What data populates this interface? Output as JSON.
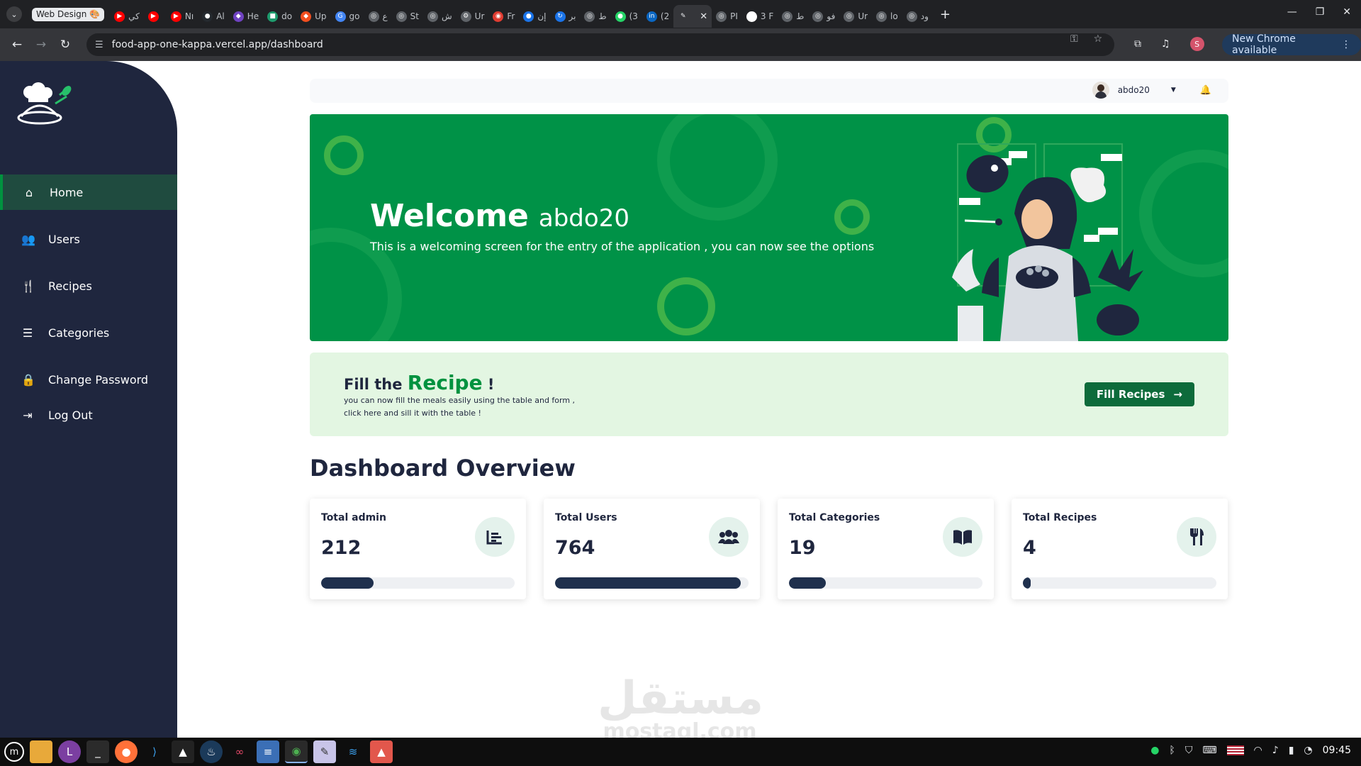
{
  "browser": {
    "group_chip": "Web Design 🎨",
    "tabs": [
      {
        "label": "كي",
        "color": "#ff0000",
        "glyph": "▶"
      },
      {
        "label": "",
        "color": "#ff0000",
        "glyph": "▶"
      },
      {
        "label": "Nı",
        "color": "#ff0000",
        "glyph": "▶"
      },
      {
        "label": "Al",
        "color": "#24292e",
        "glyph": "●"
      },
      {
        "label": "He",
        "color": "#6f42c1",
        "glyph": "◆"
      },
      {
        "label": "do",
        "color": "#1d9a6c",
        "glyph": "■"
      },
      {
        "label": "Up",
        "color": "#f24e1e",
        "glyph": "◆"
      },
      {
        "label": "go",
        "color": "#4285f4",
        "glyph": "G"
      },
      {
        "label": "ع",
        "color": "#5f6368",
        "glyph": "◎"
      },
      {
        "label": "St",
        "color": "#5f6368",
        "glyph": "◎"
      },
      {
        "label": "ش",
        "color": "#5f6368",
        "glyph": "◎"
      },
      {
        "label": "Ur",
        "color": "#5f6368",
        "glyph": "⚙"
      },
      {
        "label": "Fr",
        "color": "#e03c31",
        "glyph": "◉"
      },
      {
        "label": "إن",
        "color": "#1a73e8",
        "glyph": "●"
      },
      {
        "label": "بر",
        "color": "#1a73e8",
        "glyph": "↻"
      },
      {
        "label": "ط",
        "color": "#5f6368",
        "glyph": "◎"
      },
      {
        "label": "(3",
        "color": "#25d366",
        "glyph": "●"
      },
      {
        "label": "(2",
        "color": "#0a66c2",
        "glyph": "in"
      }
    ],
    "active_tab": {
      "label": "",
      "glyph": "✎"
    },
    "tabs_right": [
      {
        "label": "PI",
        "color": "#5f6368",
        "glyph": "◎"
      },
      {
        "label": "3 F",
        "color": "#ffffff",
        "glyph": "i"
      },
      {
        "label": "ط",
        "color": "#5f6368",
        "glyph": "◎"
      },
      {
        "label": "فو",
        "color": "#5f6368",
        "glyph": "◎"
      },
      {
        "label": "Ur",
        "color": "#5f6368",
        "glyph": "◎"
      },
      {
        "label": "lo",
        "color": "#5f6368",
        "glyph": "◎"
      },
      {
        "label": "ود",
        "color": "#5f6368",
        "glyph": "◎"
      }
    ],
    "url": "food-app-one-kappa.vercel.app/dashboard",
    "update_label": "New Chrome available",
    "profile_initial": "S"
  },
  "sidebar": {
    "items": [
      {
        "label": "Home",
        "icon": "home-icon"
      },
      {
        "label": "Users",
        "icon": "users-icon"
      },
      {
        "label": "Recipes",
        "icon": "utensils-icon"
      },
      {
        "label": "Categories",
        "icon": "list-icon"
      },
      {
        "label": "Change Password",
        "icon": "lock-icon"
      },
      {
        "label": "Log Out",
        "icon": "logout-icon"
      }
    ]
  },
  "topbar": {
    "username": "abdo20"
  },
  "hero": {
    "welcome": "Welcome",
    "username": "abdo20",
    "subtitle": "This is a welcoming screen for the entry of the application , you can now see the options"
  },
  "fill_card": {
    "title_prefix": "Fill the",
    "title_accent": "Recipe",
    "title_suffix": "!",
    "desc_line1": "you can now fill the meals easily using the table and form ,",
    "desc_line2": "click here and sill it with the table !",
    "button_label": "Fill Recipes"
  },
  "overview": {
    "title": "Dashboard Overview",
    "stats": [
      {
        "label": "Total admin",
        "value": "212",
        "icon": "bar-chart-icon",
        "progress": 0.27
      },
      {
        "label": "Total Users",
        "value": "764",
        "icon": "users-icon",
        "progress": 0.96
      },
      {
        "label": "Total Categories",
        "value": "19",
        "icon": "book-icon",
        "progress": 0.19
      },
      {
        "label": "Total Recipes",
        "value": "4",
        "icon": "utensils-icon",
        "progress": 0.04
      }
    ]
  },
  "watermark": {
    "arabic": "مستقل",
    "latin": "mostaql.com"
  },
  "taskbar": {
    "clock": "09:45"
  },
  "colors": {
    "brand_green": "#009247",
    "sidebar_bg": "#1f263e",
    "button_green": "#0d6b3b",
    "progress_fill": "#1f304d"
  }
}
